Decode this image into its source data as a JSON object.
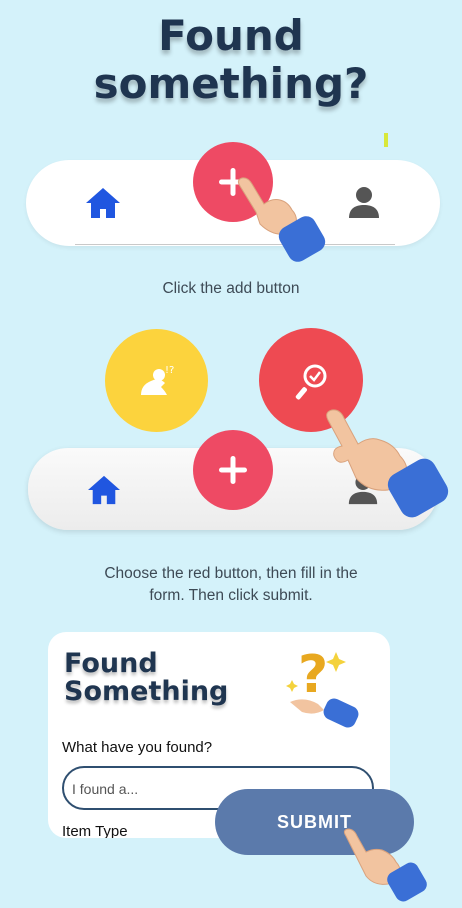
{
  "title": {
    "line1": "Found",
    "line2": "something?"
  },
  "step1": {
    "caption": "Click the add button"
  },
  "step2": {
    "caption_line1": "Choose the red button, then fill in the",
    "caption_line2": "form. Then click submit."
  },
  "form": {
    "title_line1": "Found",
    "title_line2": "Something",
    "question_label": "What have you found?",
    "input_placeholder": "I found a...",
    "item_type_label": "Item Type",
    "submit_label": "SUBMIT"
  },
  "icons": {
    "home": "home-icon",
    "plus": "plus-icon",
    "user": "user-icon",
    "lost": "lost-item-icon",
    "found": "found-item-icon",
    "pointer": "pointing-hand-icon"
  },
  "colors": {
    "background": "#d4f2fa",
    "title": "#1f3550",
    "accent_red": "#ee4a64",
    "accent_yellow": "#fcd33d",
    "home_blue": "#2056e0",
    "submit_blue": "#5b7aab"
  }
}
